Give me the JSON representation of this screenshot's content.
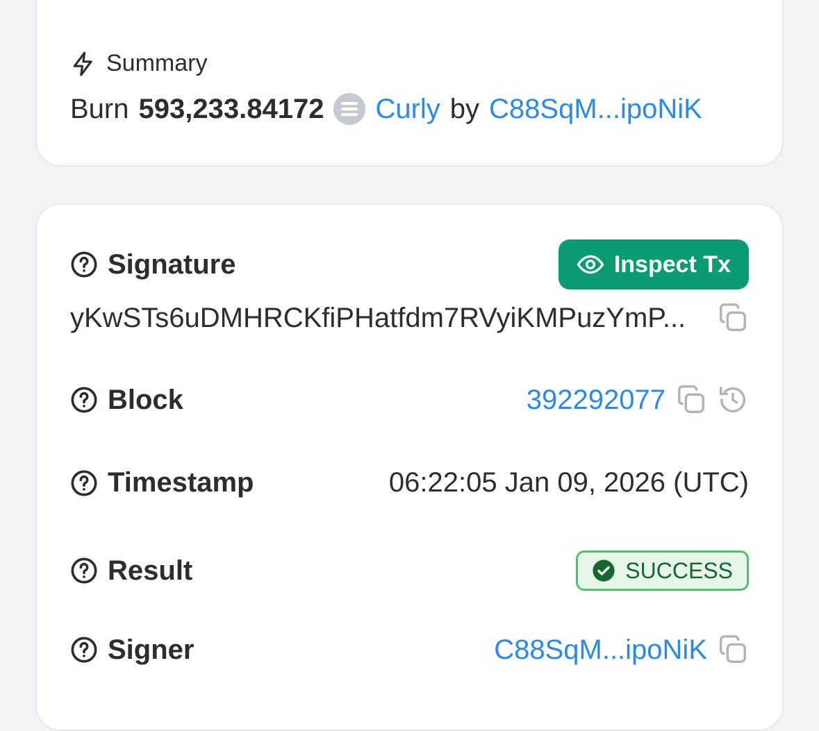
{
  "summary": {
    "heading": "Summary",
    "action": "Burn",
    "amount": "593,233.84172",
    "token": "Curly",
    "by": "by",
    "account": "C88SqM...ipoNiK"
  },
  "details": {
    "signature": {
      "label": "Signature",
      "button": "Inspect Tx",
      "value": "yKwSTs6uDMHRCKfiPHatfdm7RVyiKMPuzYmP..."
    },
    "block": {
      "label": "Block",
      "value": "392292077"
    },
    "timestamp": {
      "label": "Timestamp",
      "value": "06:22:05 Jan 09, 2026 (UTC)"
    },
    "result": {
      "label": "Result",
      "value": "SUCCESS"
    },
    "signer": {
      "label": "Signer",
      "value": "C88SqM...ipoNiK"
    }
  },
  "colors": {
    "accent": "#2a8ae6",
    "button": "#0a9b72",
    "success_bg": "#e6f7ea",
    "success_border": "#4fbf69",
    "success_text": "#17662f"
  },
  "icons": [
    "lightning-icon",
    "token-icon",
    "help-icon",
    "eye-icon",
    "copy-icon",
    "history-icon",
    "check-circle-icon"
  ]
}
